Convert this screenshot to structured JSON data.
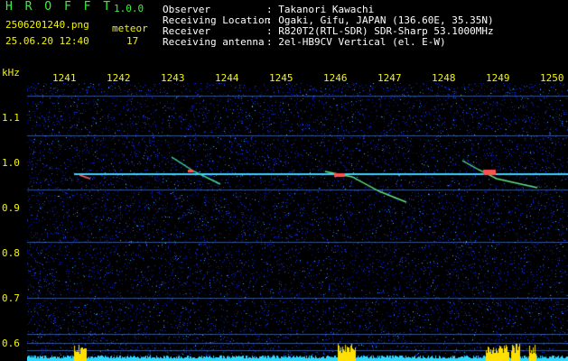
{
  "app": {
    "name": "H R O F F T",
    "version": "1.0.0"
  },
  "file": {
    "name": "2506201240.png",
    "datetime": "25.06.20 12:40"
  },
  "meteor": {
    "label": "meteor",
    "count": "17"
  },
  "info": [
    {
      "key": "Observer",
      "value": ": Takanori Kawachi"
    },
    {
      "key": "Receiving Location",
      "value": ": Ogaki, Gifu, JAPAN (136.60E, 35.35N)"
    },
    {
      "key": "Receiver",
      "value": ": R820T2(RTL-SDR) SDR-Sharp 53.1000MHz"
    },
    {
      "key": "Receiving antenna",
      "value": ": 2el-HB9CV Vertical (el. E-W)"
    }
  ],
  "axis": {
    "unit": "kHz",
    "x_ticks": [
      "1241",
      "1242",
      "1243",
      "1244",
      "1245",
      "1246",
      "1247",
      "1248",
      "1249",
      "1250"
    ],
    "y_ticks": [
      "1.1",
      "1.0",
      "0.9",
      "0.8",
      "0.7",
      "0.6"
    ]
  },
  "colors": {
    "text_green": "#3cf03c",
    "text_yellow": "#f5f500",
    "background": "#000000",
    "noise": "#1020c0",
    "carrier": "#40d0ff"
  }
}
